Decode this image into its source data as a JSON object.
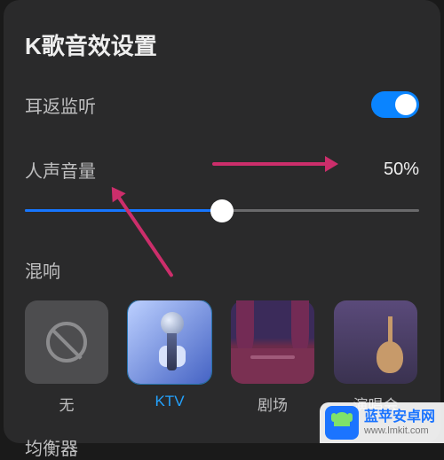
{
  "title": "K歌音效设置",
  "monitor": {
    "label": "耳返监听",
    "enabled": true
  },
  "vocal_volume": {
    "label": "人声音量",
    "value": 50,
    "value_text": "50%"
  },
  "reverb": {
    "label": "混响",
    "presets": [
      {
        "id": "none",
        "label": "无",
        "selected": false
      },
      {
        "id": "ktv",
        "label": "KTV",
        "selected": true
      },
      {
        "id": "theater",
        "label": "剧场",
        "selected": false
      },
      {
        "id": "concert",
        "label": "演唱会",
        "selected": false
      }
    ]
  },
  "equalizer": {
    "label": "均衡器"
  },
  "annotations": {
    "arrows": [
      "volume-right",
      "preset-none"
    ]
  },
  "watermark": {
    "title": "蓝苹安卓网",
    "url": "www.lmkit.com"
  },
  "colors": {
    "accent": "#0a84ff",
    "selected_text": "#24a3ff",
    "annotation": "#cc2e6b"
  }
}
